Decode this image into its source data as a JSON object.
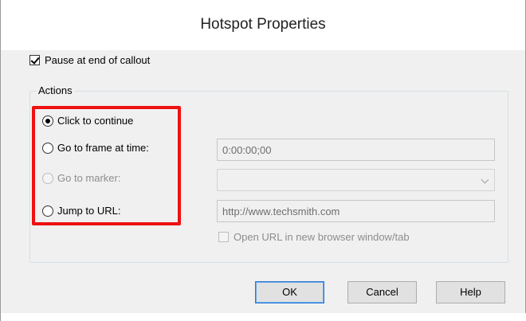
{
  "dialog": {
    "title": "Hotspot Properties"
  },
  "pause_checkbox": {
    "label": "Pause at end of callout",
    "checked": true
  },
  "actions_group": {
    "legend": "Actions",
    "options": [
      {
        "label": "Click to continue",
        "selected": true,
        "enabled": true
      },
      {
        "label": "Go to frame at time:",
        "selected": false,
        "enabled": true
      },
      {
        "label": "Go to marker:",
        "selected": false,
        "enabled": false
      },
      {
        "label": "Jump to URL:",
        "selected": false,
        "enabled": true
      }
    ],
    "time_field": {
      "value": "0:00:00;00"
    },
    "marker_combo": {
      "value": ""
    },
    "url_field": {
      "value": "http://www.techsmith.com"
    },
    "new_window_checkbox": {
      "label": "Open URL in new browser window/tab",
      "checked": false,
      "enabled": false
    }
  },
  "buttons": {
    "ok": "OK",
    "cancel": "Cancel",
    "help": "Help"
  },
  "colors": {
    "highlight": "#ee1111",
    "default_button_border": "#2b7ad6"
  }
}
